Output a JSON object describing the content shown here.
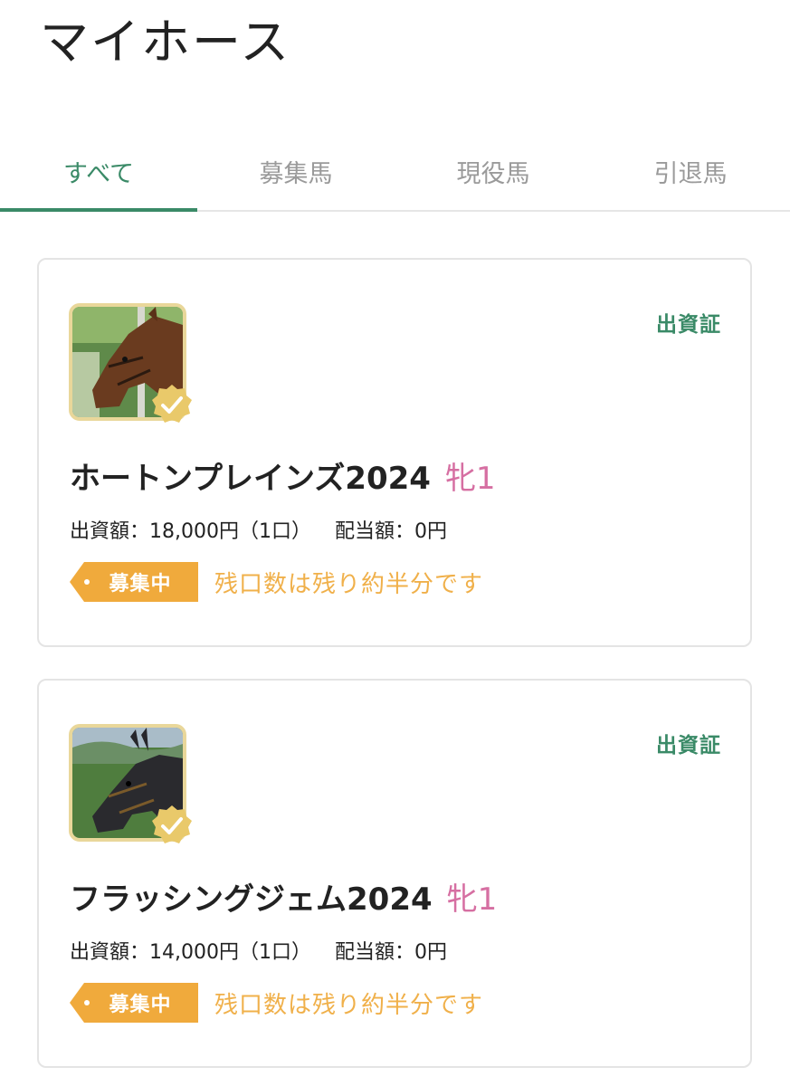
{
  "page": {
    "title": "マイホース"
  },
  "tabs": [
    {
      "label": "すべて",
      "active": true
    },
    {
      "label": "募集馬",
      "active": false
    },
    {
      "label": "現役馬",
      "active": false
    },
    {
      "label": "引退馬",
      "active": false
    }
  ],
  "horses": [
    {
      "name": "ホートンプレインズ2024",
      "sex_age": "牝1",
      "investment": "出資額：18,000円（1口）",
      "dividend": "配当額：0円",
      "status": "募集中",
      "remaining": "残口数は残り約半分です",
      "certificate": "出資証",
      "photo_icon": "bay-horse-photo"
    },
    {
      "name": "フラッシングジェム2024",
      "sex_age": "牝1",
      "investment": "出資額：14,000円（1口）",
      "dividend": "配当額：0円",
      "status": "募集中",
      "remaining": "残口数は残り約半分です",
      "certificate": "出資証",
      "photo_icon": "dark-horse-photo"
    }
  ],
  "colors": {
    "accent": "#3a8a67",
    "sex": "#d66fa2",
    "status_tag": "#f0aa3c",
    "remaining": "#f0b04a",
    "thumb_border": "#e9d79a"
  }
}
